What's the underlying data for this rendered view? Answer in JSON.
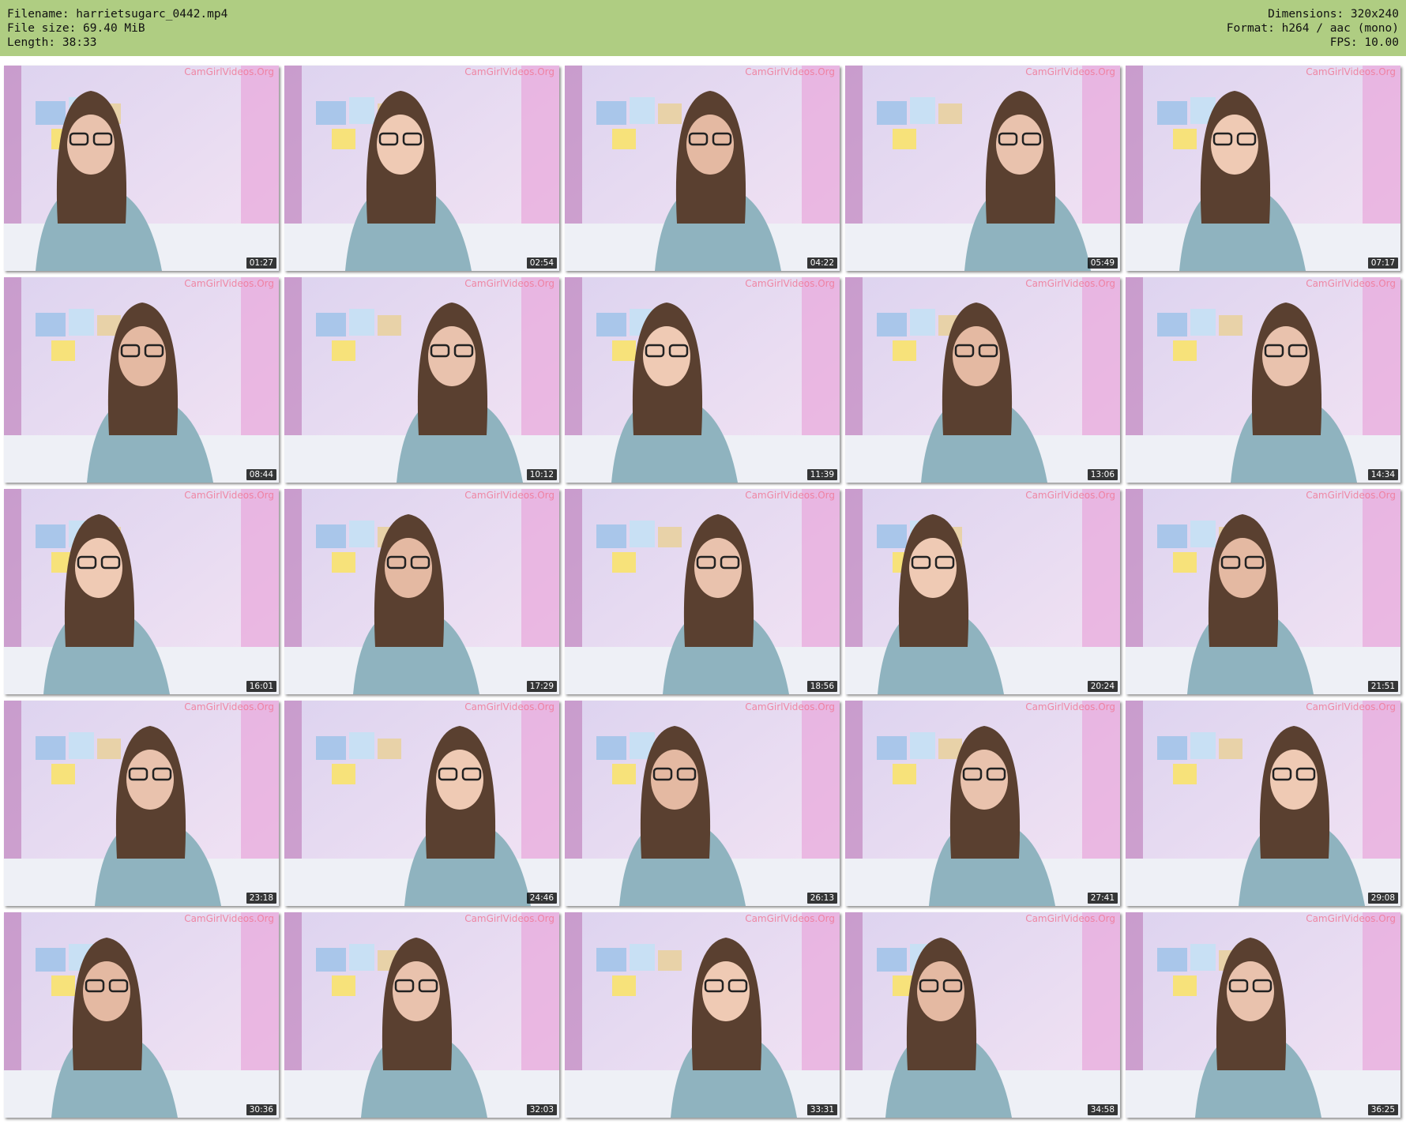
{
  "header": {
    "filename": "Filename: harrietsugarc_0442.mp4",
    "filesize": "File size: 69.40 MiB",
    "length": "Length: 38:33",
    "dimensions": "Dimensions: 320x240",
    "format": "Format: h264 / aac (mono)",
    "fps": "FPS: 10.00"
  },
  "colors": {
    "header_bg": "#afcd82",
    "watermark": "#f07896"
  },
  "watermark": "CamGirlVideos.Org",
  "thumbnails": [
    {
      "time": "01:27"
    },
    {
      "time": "02:54"
    },
    {
      "time": "04:22"
    },
    {
      "time": "05:49"
    },
    {
      "time": "07:17"
    },
    {
      "time": "08:44"
    },
    {
      "time": "10:12"
    },
    {
      "time": "11:39"
    },
    {
      "time": "13:06"
    },
    {
      "time": "14:34"
    },
    {
      "time": "16:01"
    },
    {
      "time": "17:29"
    },
    {
      "time": "18:56"
    },
    {
      "time": "20:24"
    },
    {
      "time": "21:51"
    },
    {
      "time": "23:18"
    },
    {
      "time": "24:46"
    },
    {
      "time": "26:13"
    },
    {
      "time": "27:41"
    },
    {
      "time": "29:08"
    },
    {
      "time": "30:36"
    },
    {
      "time": "32:03"
    },
    {
      "time": "33:31"
    },
    {
      "time": "34:58"
    },
    {
      "time": "36:25"
    }
  ]
}
